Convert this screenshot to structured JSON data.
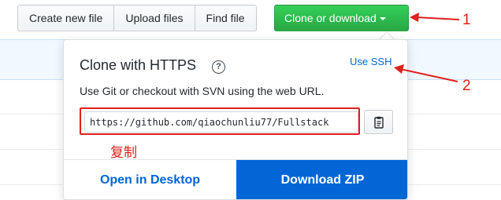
{
  "toolbar": {
    "create_new_file": "Create new file",
    "upload_files": "Upload files",
    "find_file": "Find file",
    "clone_or_download": "Clone or download"
  },
  "clone_panel": {
    "title": "Clone with HTTPS",
    "help_symbol": "?",
    "use_ssh": "Use SSH",
    "description": "Use Git or checkout with SVN using the web URL.",
    "url_value": "https://github.com/qiaochunliu77/Fullstack",
    "copy_icon": "clipboard-icon",
    "open_in_desktop": "Open in Desktop",
    "download_zip": "Download ZIP"
  },
  "annotations": {
    "copy_note": "复制",
    "marker_1": "1",
    "marker_2": "2",
    "color": "#e0201b"
  },
  "colors": {
    "clone_button": "#28a745",
    "link": "#0366d6",
    "download_zip_bg": "#0366d6"
  }
}
